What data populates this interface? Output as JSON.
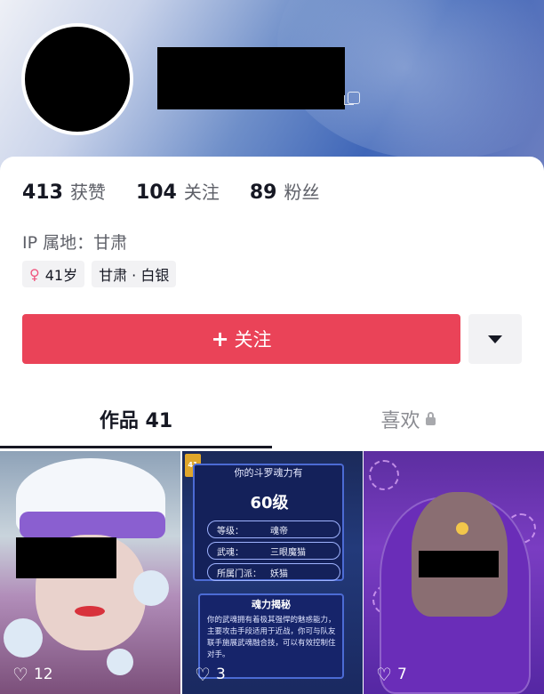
{
  "profile": {
    "stats": [
      {
        "value": "413",
        "label": "获赞"
      },
      {
        "value": "104",
        "label": "关注"
      },
      {
        "value": "89",
        "label": "粉丝"
      }
    ],
    "ip": "IP 属地：甘肃",
    "tags": {
      "age": "41岁",
      "location": "甘肃 · 白银"
    }
  },
  "actions": {
    "follow": "关注"
  },
  "tabs": {
    "works": "作品 41",
    "likes": "喜欢"
  },
  "thumbs": [
    {
      "likes": "12"
    },
    {
      "likes": "3",
      "badge": "41",
      "title": "你的斗罗魂力有",
      "level": "60级",
      "rows": [
        {
          "k": "等级：",
          "v": "魂帝"
        },
        {
          "k": "武魂：",
          "v": "三眼魔猫"
        },
        {
          "k": "所属门派：",
          "v": "妖猫"
        }
      ],
      "secret_title": "魂力揭秘",
      "secret_body": "你的武魂拥有着极其强悍的魅惑能力，主要攻击手段适用于近战，你可与队友联手施展武魂融合技，可以有效控制住对手。"
    },
    {
      "likes": "7"
    }
  ],
  "colors": {
    "accent": "#ea4358",
    "text": "#161823",
    "muted": "#5d5f67"
  }
}
